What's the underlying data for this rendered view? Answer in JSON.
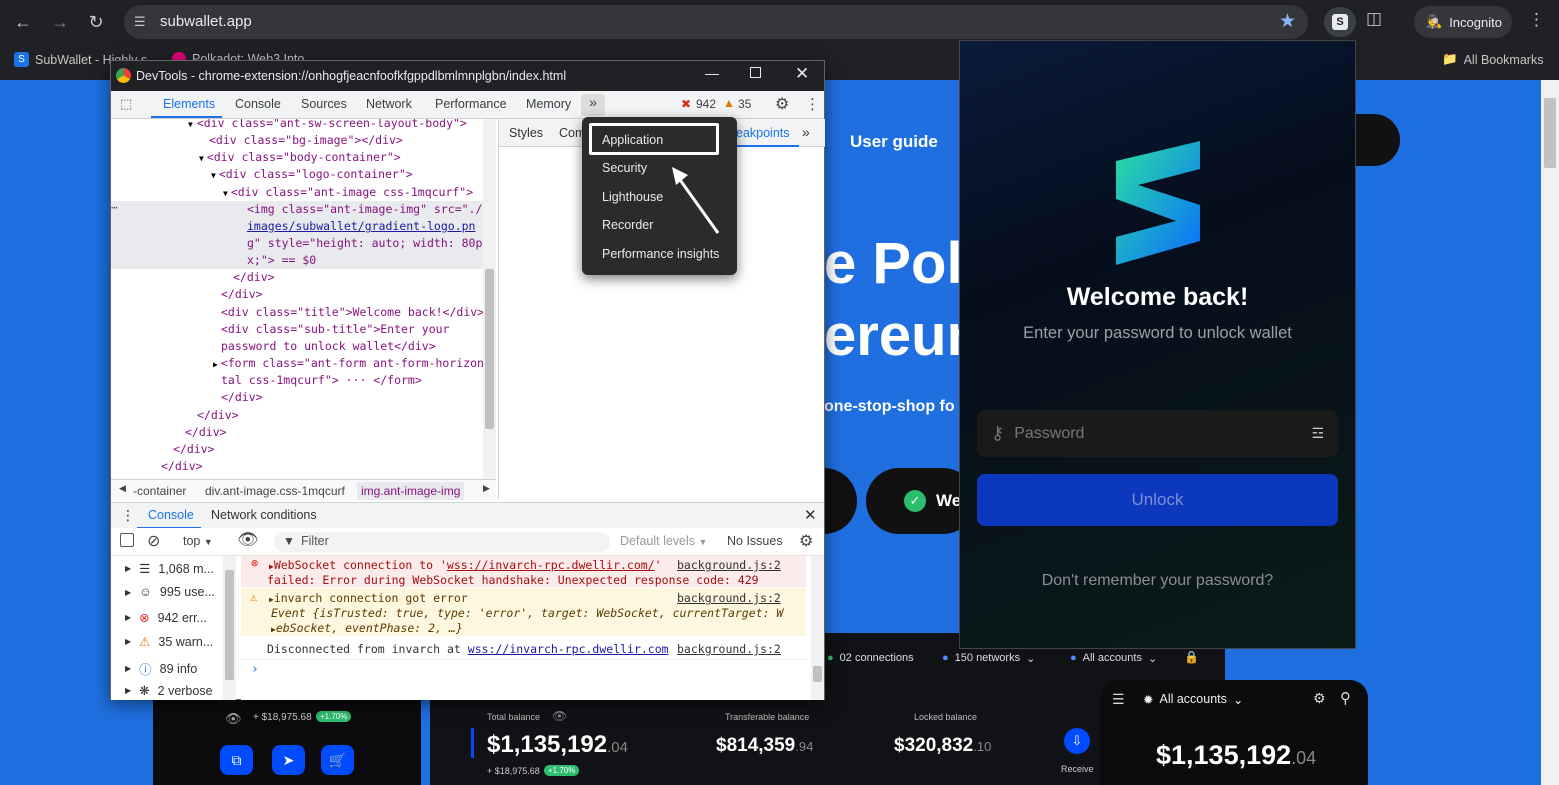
{
  "browser": {
    "url": "subwallet.app",
    "incognito_label": "Incognito",
    "bookmarks": [
      "SubWallet - Highly s...",
      "Polkadot: Web3 Into..."
    ],
    "all_bookmarks": "All Bookmarks"
  },
  "devtools": {
    "title": "DevTools - chrome-extension://onhogfjeacnfoofkfgppdlbmlmnplgbn/index.html",
    "tabs": [
      "Elements",
      "Console",
      "Sources",
      "Network",
      "Performance",
      "Memory"
    ],
    "error_count": "942",
    "warning_count": "35",
    "side_tabs": [
      "Styles",
      "Com",
      "eakpoints"
    ],
    "dom_lines": [
      "<div class=\"ant-sw-screen-layout-body\">",
      "<div class=\"bg-image\"></div>",
      "<div class=\"body-container\">",
      "<div class=\"logo-container\">",
      "<div class=\"ant-image css-1mqcurf\">",
      "<img class=\"ant-image-img\" src=\"./",
      "images/subwallet/gradient-logo.pn",
      "g\" style=\"height: auto; width: 80p",
      "x;\"> == $0",
      "</div>",
      "</div>",
      "<div class=\"title\">Welcome back!</div>",
      "<div class=\"sub-title\">Enter your",
      "password to unlock wallet</div>",
      "<form class=\"ant-form ant-form-horizon",
      "tal css-1mqcurf\"> ··· </form>",
      "</div>",
      "</div>",
      "</div>",
      "</div>",
      "</div>"
    ],
    "breadcrumbs": [
      "-container",
      "div.ant-image.css-1mqcurf",
      "img.ant-image-img"
    ],
    "more_menu": {
      "items": [
        "Application",
        "Security",
        "Lighthouse",
        "Recorder",
        "Performance insights"
      ],
      "selected": "Application"
    },
    "console": {
      "drawer_tabs": [
        "Console",
        "Network conditions"
      ],
      "context": "top",
      "filter_placeholder": "Filter",
      "levels": "Default levels",
      "issues": "No Issues",
      "sidebar": [
        {
          "icon": "list-icon",
          "label": "1,068 m..."
        },
        {
          "icon": "user-icon",
          "label": "995 use..."
        },
        {
          "icon": "error-icon",
          "label": "942 err..."
        },
        {
          "icon": "warning-icon",
          "label": "35 warn..."
        },
        {
          "icon": "info-icon",
          "label": "89 info"
        },
        {
          "icon": "bug-icon",
          "label": "2 verbose"
        }
      ],
      "messages": [
        {
          "level": "error",
          "line1_pre": "WebSocket connection to '",
          "link": "wss://invarch-rpc.dwellir.com/",
          "line1_post": "'",
          "line2": "failed: Error during WebSocket handshake: Unexpected response code: 429",
          "source": "background.js:2"
        },
        {
          "level": "warning",
          "line1": "invarch connection got error",
          "line2": "Event {isTrusted: true, type: 'error', target: WebSocket, currentTarget: W",
          "line3": "ebSocket, eventPhase: 2, …}",
          "source": "background.js:2"
        },
        {
          "level": "log",
          "line1_pre": "Disconnected from invarch at ",
          "link": "wss://invarch-rpc.dwellir.com",
          "source": "background.js:2"
        }
      ]
    }
  },
  "website": {
    "nav_user_guide": "User guide",
    "hero_line1": "e Poll",
    "hero_line2": "ereum",
    "hero_sub": "one-stop-shop fo",
    "cta_label": "We",
    "dashboard": {
      "connections": "02 connections",
      "networks": "150 networks",
      "accounts": "All accounts",
      "small_change": "+ $18,975.68",
      "small_pct": "+1.70%",
      "total_balance_label": "Total balance",
      "total_balance": "$1,135,192",
      "total_balance_dec": ".04",
      "transferable_label": "Transferable balance",
      "transferable": "$814,359",
      "transferable_dec": ".94",
      "locked_label": "Locked balance",
      "locked": "$320,832",
      "locked_dec": ".10",
      "receive_label": "Receive",
      "mobile_accounts": "All accounts",
      "mobile_balance": "$1,135,192",
      "mobile_balance_dec": ".04"
    }
  },
  "wallet": {
    "title": "Welcome back!",
    "subtitle": "Enter your password to unlock wallet",
    "password_placeholder": "Password",
    "unlock_label": "Unlock",
    "forgot_label": "Don't remember your password?"
  },
  "colors": {
    "accent": "#1a73e8",
    "unlock_button": "#004bff",
    "site_bg": "#1f6fe0",
    "error_bg": "#fcebeb",
    "warning_bg": "#fef7e0"
  }
}
